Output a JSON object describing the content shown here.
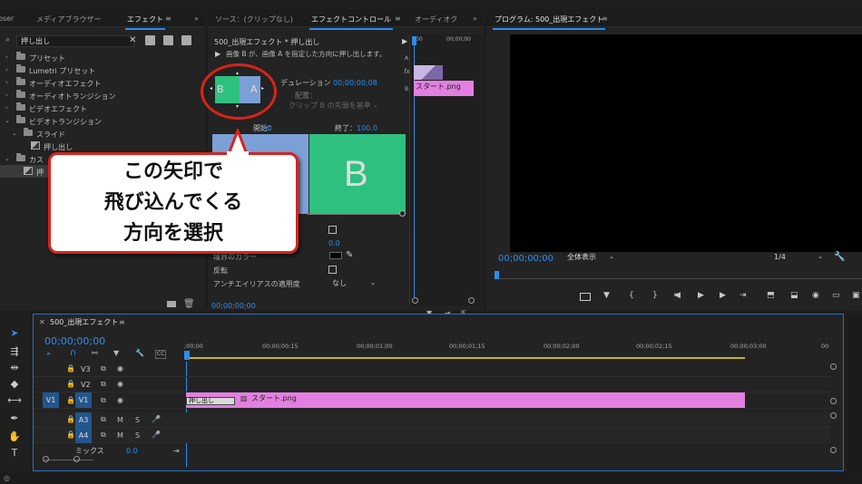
{
  "effects_panel": {
    "tabs": [
      "oser",
      "メディアブラウザー",
      "エフェクト"
    ],
    "more": "»",
    "search_value": "押し出し",
    "tree": [
      {
        "label": "プリセット",
        "type": "folder",
        "indent": 0
      },
      {
        "label": "Lumetri プリセット",
        "type": "folder",
        "indent": 0
      },
      {
        "label": "オーディオエフェクト",
        "type": "folder",
        "indent": 0
      },
      {
        "label": "オーディオトランジション",
        "type": "folder",
        "indent": 0
      },
      {
        "label": "ビデオエフェクト",
        "type": "folder",
        "indent": 0
      },
      {
        "label": "ビデオトランジション",
        "type": "folder",
        "indent": 0,
        "open": true
      },
      {
        "label": "スライド",
        "type": "folder",
        "indent": 1,
        "open": true
      },
      {
        "label": "押し出し",
        "type": "effect",
        "indent": 2
      },
      {
        "label": "カス",
        "type": "folder",
        "indent": 0,
        "open": true
      },
      {
        "label": "押",
        "type": "effect",
        "indent": 2,
        "selected": true
      }
    ]
  },
  "effect_controls": {
    "tabs": [
      "ソース：(クリップなし)",
      "エフェクトコントロール",
      "オーディオク"
    ],
    "more": "»",
    "clip_path": "500_出現エフェクト * 押し出し",
    "description": "画像 B が、画像 A を指定した方向に押し出します。",
    "thumb_labels": {
      "b": "B",
      "a": "A"
    },
    "duration_label": "デュレーション",
    "duration_value": "00;00;00;08",
    "alignment_label": "配置：",
    "alignment_value": "クリップ B の先頭を基準",
    "start_label": "開始：",
    "start_value": "0.0",
    "end_label": "終了：",
    "end_value": "100.0",
    "preview_b_letter": "B",
    "prop_value": "0.0",
    "border_color_label": "境界のカラー",
    "reverse_label": "反転",
    "antialias_label": "アンチエイリアスの適用度",
    "antialias_value": "なし",
    "timecode": "00;00;00;00",
    "mini_timeline": {
      "ticks": [
        "00",
        "00;00;00"
      ],
      "a_label": "A",
      "b_label": "B",
      "fx_label": "fx",
      "clip_label": "スタート.png"
    }
  },
  "callout": {
    "line1": "この矢印で",
    "line2": "飛び込んでくる",
    "line3": "方向を選択"
  },
  "program_monitor": {
    "title": "プログラム: 500_出現エフェクト",
    "timecode": "00;00;00;00",
    "zoom": "全体表示",
    "resolution": "1/4"
  },
  "timeline": {
    "title": "500_出現エフェクト",
    "timecode": "00;00;00;00",
    "ruler": [
      ";00;00",
      "00;00;00;15",
      "00;00;01;00",
      "00;00;01;15",
      "00;00;02;00",
      "00;00;02;15",
      "00;00;03;00",
      "00"
    ],
    "tracks": [
      {
        "name": "V3",
        "kind": "video"
      },
      {
        "name": "V2",
        "kind": "video"
      },
      {
        "name": "V1",
        "kind": "video",
        "source": "V1"
      },
      {
        "name": "A3",
        "kind": "audio"
      },
      {
        "name": "A4",
        "kind": "audio"
      }
    ],
    "mix_label": "ミックス",
    "mix_value": "0.0",
    "transition_label": "押し出し",
    "clip_label": "スタート.png",
    "track_m": "M",
    "track_s": "S",
    "cc_label": "CC"
  },
  "colors": {
    "accent": "#2d8ceb",
    "clip_pink": "#e37fe0",
    "green": "#2ec07f",
    "blue_tile": "#7aa0d6",
    "callout_red": "#d9231b"
  }
}
